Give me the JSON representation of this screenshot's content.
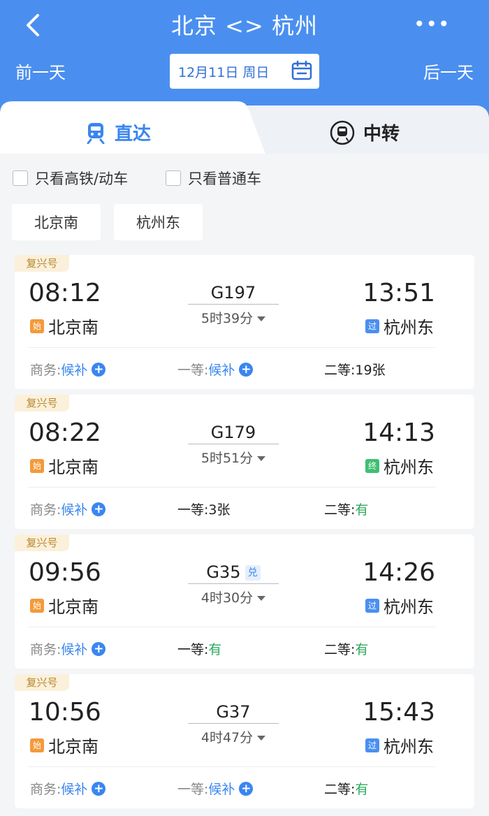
{
  "header": {
    "title": "北京 <> 杭州",
    "more": "•••",
    "prev_day": "前一天",
    "next_day": "后一天",
    "date": "12月11日  周日"
  },
  "tabs": {
    "direct": "直达",
    "transfer": "中转"
  },
  "filters": {
    "highspeed_only": "只看高铁/动车",
    "regular_only": "只看普通车",
    "from_station": "北京南",
    "to_station": "杭州东"
  },
  "colors": {
    "header_blue": "#4a8ff0",
    "accent_blue": "#3a86f0",
    "available_green": "#2daa5e",
    "origin_orange": "#f39a3a",
    "pass_blue": "#4a8ff0",
    "terminal_green": "#3fbf72"
  },
  "trains": [
    {
      "badge": "复兴号",
      "dep_time": "08:12",
      "dep_tag": "始",
      "dep_station": "北京南",
      "train_no": "G197",
      "duration": "5时39分",
      "arr_time": "13:51",
      "arr_tag": "过",
      "arr_station": "杭州东",
      "seats": {
        "business_label": "商务:",
        "business": "候补",
        "first_label": "一等:",
        "first": "候补",
        "second_label": "二等:",
        "second": "19张"
      }
    },
    {
      "badge": "复兴号",
      "dep_time": "08:22",
      "dep_tag": "始",
      "dep_station": "北京南",
      "train_no": "G179",
      "duration": "5时51分",
      "arr_time": "14:13",
      "arr_tag": "终",
      "arr_station": "杭州东",
      "seats": {
        "business_label": "商务:",
        "business": "候补",
        "first_label": "一等:",
        "first": "3张",
        "second_label": "二等:",
        "second": "有"
      }
    },
    {
      "badge": "复兴号",
      "dep_time": "09:56",
      "dep_tag": "始",
      "dep_station": "北京南",
      "train_no": "G35",
      "train_mark": "兑",
      "duration": "4时30分",
      "arr_time": "14:26",
      "arr_tag": "过",
      "arr_station": "杭州东",
      "seats": {
        "business_label": "商务:",
        "business": "候补",
        "first_label": "一等:",
        "first": "有",
        "second_label": "二等:",
        "second": "有"
      }
    },
    {
      "badge": "复兴号",
      "dep_time": "10:56",
      "dep_tag": "始",
      "dep_station": "北京南",
      "train_no": "G37",
      "duration": "4时47分",
      "arr_time": "15:43",
      "arr_tag": "过",
      "arr_station": "杭州东",
      "seats": {
        "business_label": "商务:",
        "business": "候补",
        "first_label": "一等:",
        "first": "候补",
        "second_label": "二等:",
        "second": "有"
      }
    }
  ]
}
